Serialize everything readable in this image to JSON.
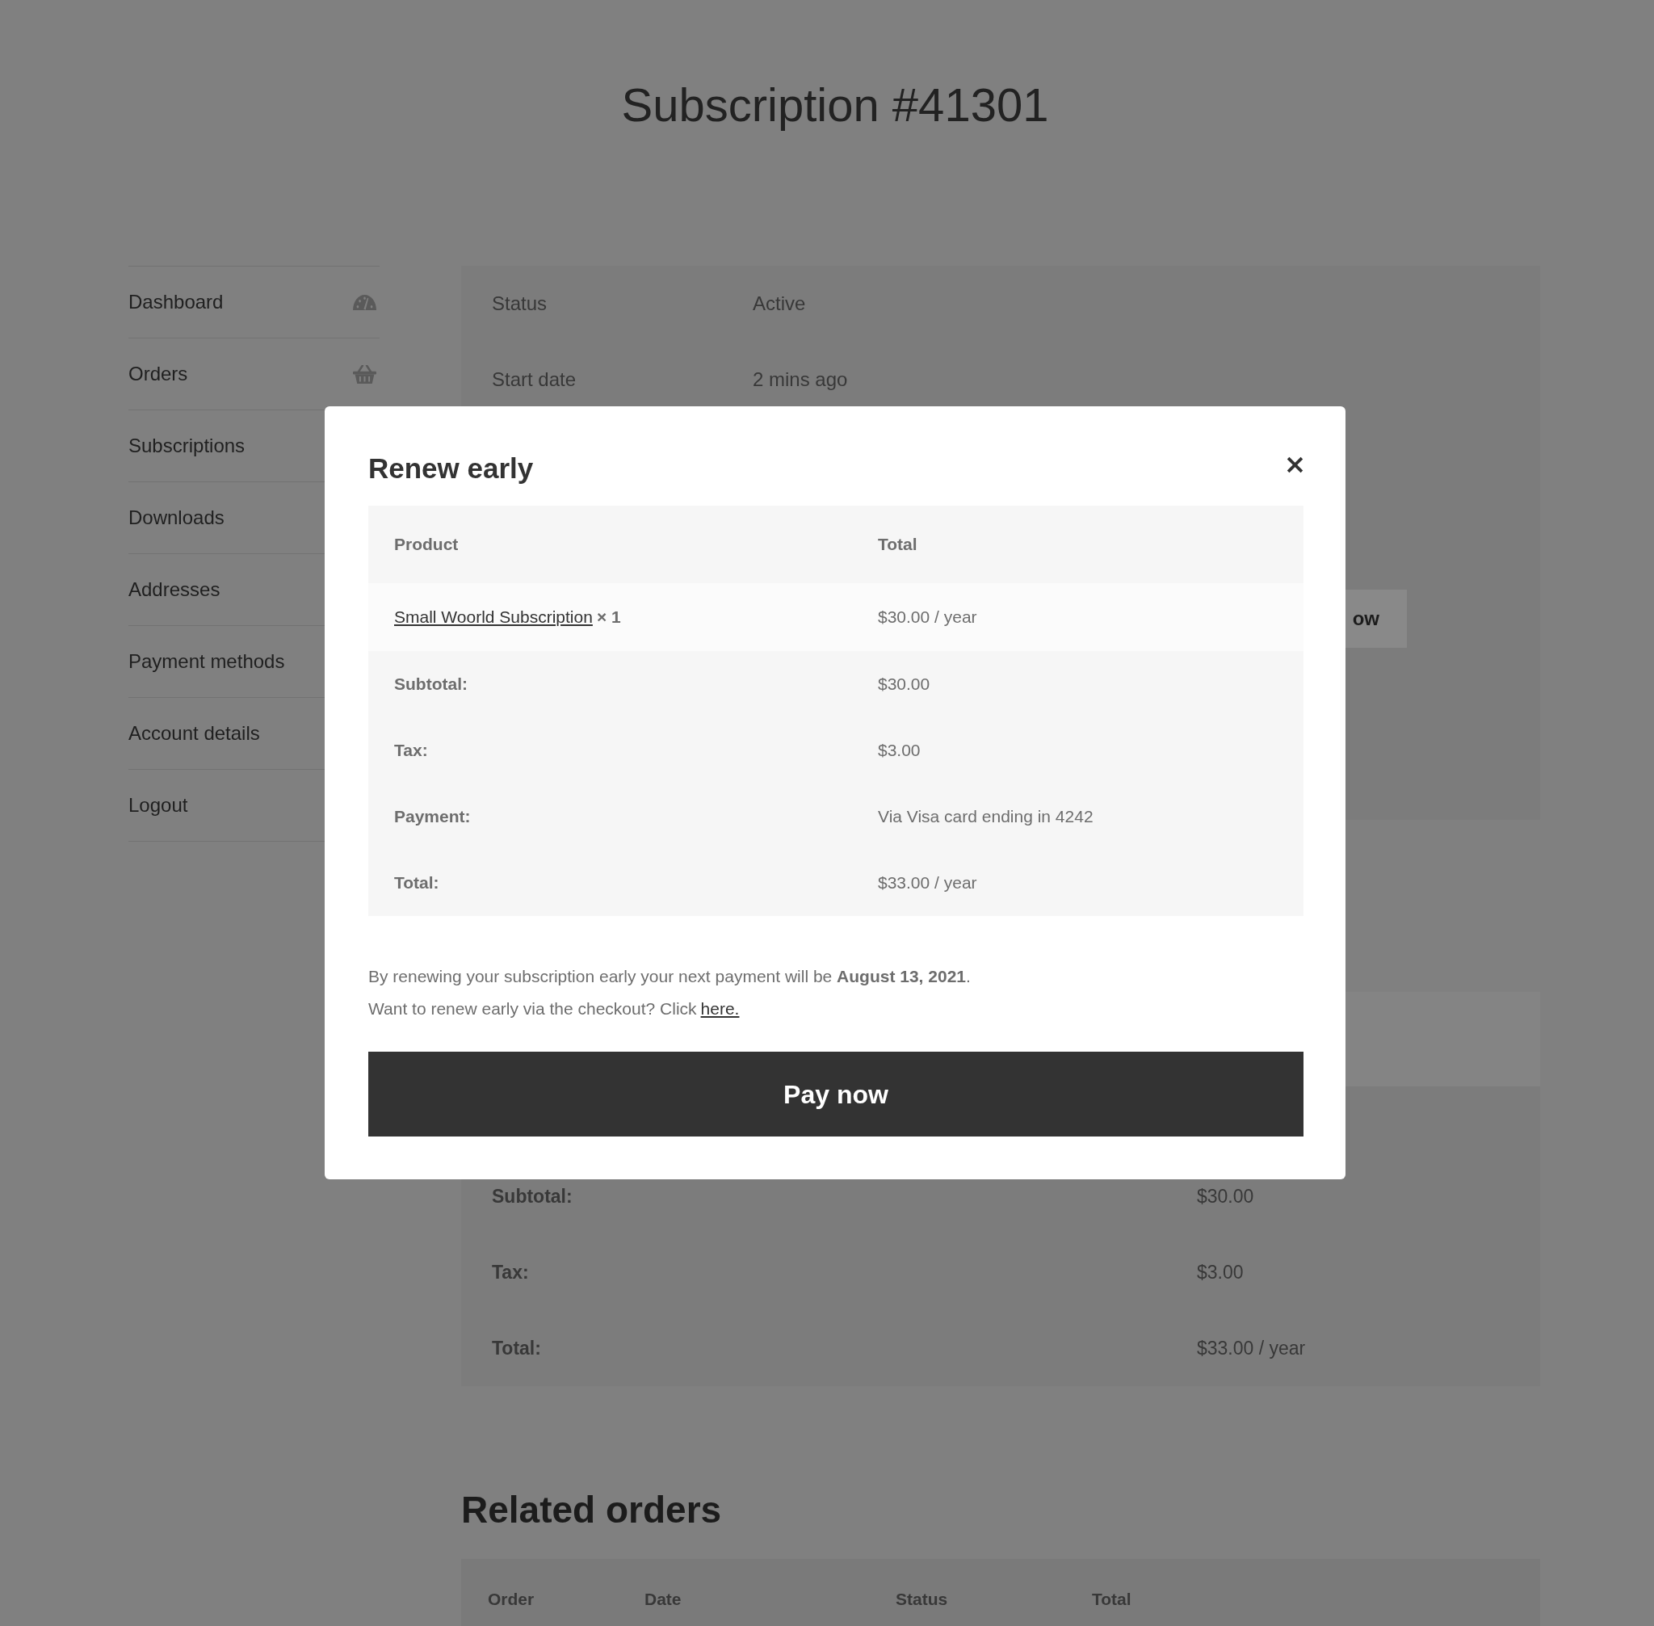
{
  "page": {
    "title": "Subscription #41301"
  },
  "sidebar": {
    "items": [
      "Dashboard",
      "Orders",
      "Subscriptions",
      "Downloads",
      "Addresses",
      "Payment methods",
      "Account details",
      "Logout"
    ]
  },
  "details": {
    "rows": [
      {
        "label": "Status",
        "value": "Active"
      },
      {
        "label": "Start date",
        "value": "2 mins ago"
      }
    ],
    "action_button": "ow"
  },
  "totals": {
    "rows": [
      {
        "label": "Subtotal:",
        "value": "$30.00"
      },
      {
        "label": "Tax:",
        "value": "$3.00"
      },
      {
        "label": "Total:",
        "value": "$33.00 / year"
      }
    ]
  },
  "related_orders": {
    "title": "Related orders",
    "columns": [
      "Order",
      "Date",
      "Status",
      "Total"
    ]
  },
  "modal": {
    "title": "Renew early",
    "table": {
      "columns": [
        "Product",
        "Total"
      ],
      "items": [
        {
          "product": "Small Woorld Subscription",
          "quantity": "× 1",
          "total": "$30.00 / year"
        }
      ],
      "summary": [
        {
          "label": "Subtotal:",
          "value": "$30.00"
        },
        {
          "label": "Tax:",
          "value": "$3.00"
        },
        {
          "label": "Payment:",
          "value": "Via Visa card ending in 4242"
        },
        {
          "label": "Total:",
          "value": "$33.00 / year"
        }
      ]
    },
    "notes": [
      {
        "text": "By renewing your subscription early your next payment will be **August 13, 2021**."
      },
      {
        "text": "Want to renew early via the checkout? Click",
        "link": "here."
      }
    ],
    "button": "Pay now"
  }
}
